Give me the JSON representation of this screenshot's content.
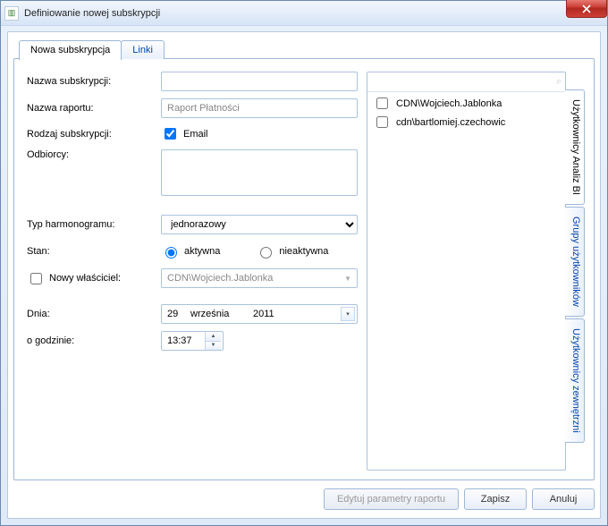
{
  "window": {
    "title": "Definiowanie nowej subskrypcji"
  },
  "tabs": {
    "main": "Nowa subskrypcja",
    "links": "Linki"
  },
  "form": {
    "name_label": "Nazwa subskrypcji:",
    "name_value": "",
    "report_label": "Nazwa raportu:",
    "report_value": "Raport Płatności",
    "type_label": "Rodzaj subskrypcji:",
    "email_label": "Email",
    "email_checked": true,
    "recipients_label": "Odbiorcy:",
    "recipients_value": "",
    "schedule_label": "Typ harmonogramu:",
    "schedule_options": [
      "jednorazowy"
    ],
    "schedule_value": "jednorazowy",
    "state_label": "Stan:",
    "state_active": "aktywna",
    "state_inactive": "nieaktywna",
    "state_value": "aktywna",
    "owner_label": "Nowy właściciel:",
    "owner_checked": false,
    "owner_value": "CDN\\Wojciech.Jablonka",
    "date_label": "Dnia:",
    "date_day": "29",
    "date_month": "września",
    "date_year": "2011",
    "time_label": "o godzinie:",
    "time_value": "13:37"
  },
  "sideTabs": {
    "tab1": "Użytkownicy Analiz BI",
    "tab2": "Grupy użytkowników",
    "tab3": "Użytkownicy zewnętrzni"
  },
  "users": {
    "search_placeholder": "",
    "items": [
      {
        "label": "CDN\\Wojciech.Jablonka",
        "checked": false
      },
      {
        "label": "cdn\\bartlomiej.czechowic",
        "checked": false
      }
    ]
  },
  "footer": {
    "edit_params": "Edytuj parametry raportu",
    "save": "Zapisz",
    "cancel": "Anuluj"
  }
}
